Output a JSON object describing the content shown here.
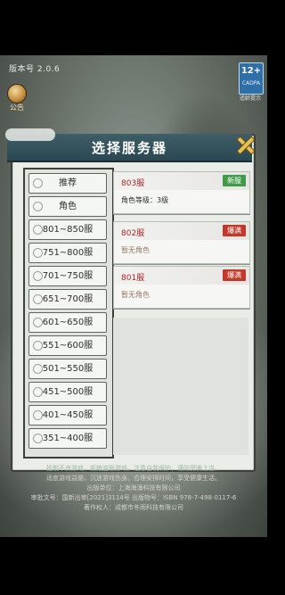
{
  "app": {
    "version_label": "版本号 2.0.6",
    "notice_label": "公告",
    "age_rating": {
      "number": "12+",
      "caption": "CADPA",
      "sub": "适龄提示"
    }
  },
  "dialog": {
    "title": "选择服务器",
    "tabs": [
      {
        "label": "推荐"
      },
      {
        "label": "角色"
      },
      {
        "label": "801~850服"
      },
      {
        "label": "751~800服"
      },
      {
        "label": "701~750服"
      },
      {
        "label": "651~700服"
      },
      {
        "label": "601~650服"
      },
      {
        "label": "551~600服"
      },
      {
        "label": "501~550服"
      },
      {
        "label": "451~500服"
      },
      {
        "label": "401~450服"
      },
      {
        "label": "351~400服"
      }
    ],
    "servers": [
      {
        "name": "803服",
        "badge": "新服",
        "badge_color": "#3f9b4a",
        "info": "角色等级：3级"
      },
      {
        "name": "802服",
        "badge": "爆满",
        "badge_color": "#c0392b",
        "info": "暂无角色"
      },
      {
        "name": "801服",
        "badge": "爆满",
        "badge_color": "#c0392b",
        "info": "暂无角色"
      }
    ]
  },
  "footer": {
    "line1": "抵制不良游戏，拒绝盗版游戏。注意自我保护，谨防受骗上当。",
    "line2": "适度游戏益脑，沉迷游戏伤身。合理安排时间，享受健康生活。",
    "line3": "出版单位：上海海涌科技有限公司",
    "line4": "审批文号：国新出审[2021]3114号 出版物号：ISBN 978-7-498-0117-6",
    "line5": "著作权人：成都市冬雨科技有限公司"
  }
}
